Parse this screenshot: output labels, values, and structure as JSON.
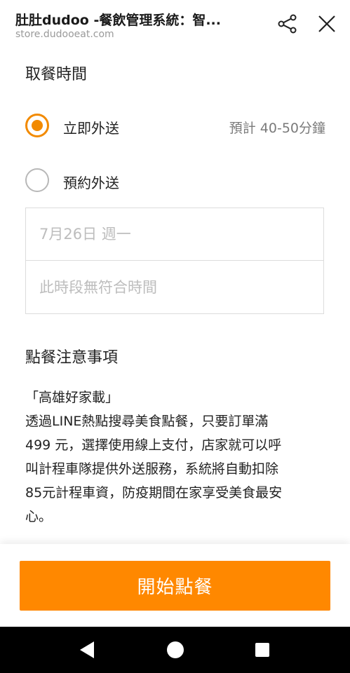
{
  "header": {
    "title": "肚肚dudoo -餐飲管理系統：智...",
    "url": "store.dudooeat.com",
    "share_icon": "share-icon",
    "close_icon": "close-icon"
  },
  "pickup": {
    "title": "取餐時間",
    "options": [
      {
        "label": "立即外送",
        "selected": true,
        "eta": "預計 40-50分鐘"
      },
      {
        "label": "預約外送",
        "selected": false
      }
    ],
    "date_placeholder": "7月26日 週一",
    "slot_placeholder": "此時段無符合時間"
  },
  "notes": {
    "title": "點餐注意事項",
    "lines": [
      "「高雄好家載」",
      "透過LINE熱點搜尋美食點餐，只要訂單滿",
      "499 元，選擇使用線上支付，店家就可以呼",
      "叫計程車隊提供外送服務，系統將自動扣除",
      "85元計程車資，防疫期間在家享受美食最安",
      "心。"
    ]
  },
  "footer": {
    "start_label": "開始點餐"
  },
  "colors": {
    "accent": "#ff8800",
    "radio": "#f28a00",
    "muted": "#bdbdbd"
  },
  "system_nav": {
    "back_icon": "back-icon",
    "home_icon": "home-icon",
    "recent_icon": "recent-apps-icon"
  }
}
